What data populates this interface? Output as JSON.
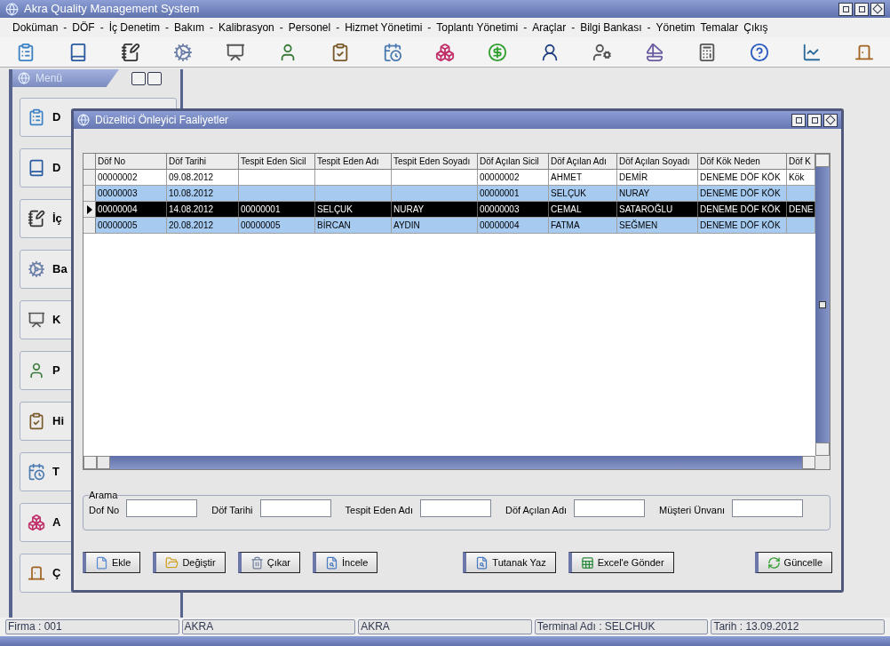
{
  "window": {
    "title": "Akra Quality Management System"
  },
  "menu_bar": [
    {
      "label": "Doküman",
      "separator": "-"
    },
    {
      "label": "DÖF",
      "separator": "-"
    },
    {
      "label": "İç Denetim",
      "separator": "-"
    },
    {
      "label": "Bakım",
      "separator": "-"
    },
    {
      "label": "Kalibrasyon",
      "separator": "-"
    },
    {
      "label": "Personel",
      "separator": "-"
    },
    {
      "label": "Hizmet Yönetimi",
      "separator": "-"
    },
    {
      "label": "Toplantı Yönetimi",
      "separator": "-"
    },
    {
      "label": "Araçlar",
      "separator": "-"
    },
    {
      "label": "Bilgi Bankası",
      "separator": "-"
    },
    {
      "label": "Yönetim"
    },
    {
      "label": "Temalar"
    },
    {
      "label": "Çıkış"
    }
  ],
  "menu_panel": {
    "title": "Menü",
    "items": [
      "D",
      "D",
      "İç",
      "Ba",
      "K",
      "P",
      "Hi",
      "T",
      "A",
      "Ç"
    ]
  },
  "dialog": {
    "title": "Düzeltici Önleyici Faaliyetler",
    "table": {
      "columns": [
        "Döf No",
        "Döf Tarihi",
        "Tespit Eden Sicil",
        "Tespit Eden Adı",
        "Tespit Eden Soyadı",
        "Döf Açılan Sicil",
        "Döf Açılan Adı",
        "Döf Açılan Soyadı",
        "Döf Kök Neden",
        "Döf K"
      ],
      "rows": [
        {
          "selected": false,
          "cells": [
            "00000002",
            "09.08.2012",
            "",
            "",
            "",
            "00000002",
            "AHMET",
            "DEMİR",
            "DENEME DÖF KÖK",
            "Kök"
          ]
        },
        {
          "selected": false,
          "cells": [
            "00000003",
            "10.08.2012",
            "",
            "",
            "",
            "00000001",
            "SELÇUK",
            "NURAY",
            "DENEME DÖF KÖK",
            ""
          ]
        },
        {
          "selected": true,
          "cells": [
            "00000004",
            "14.08.2012",
            "00000001",
            "SELÇUK",
            "NURAY",
            "00000003",
            "CEMAL",
            "SATAROĞLU",
            "DENEME DÖF KÖK",
            "DENE"
          ]
        },
        {
          "selected": false,
          "cells": [
            "00000005",
            "20.08.2012",
            "00000005",
            "BİRCAN",
            "AYDIN",
            "00000004",
            "FATMA",
            "SEĞMEN",
            "DENEME DÖF KÖK",
            ""
          ]
        }
      ]
    },
    "search": {
      "title": "Arama",
      "fields": [
        "Dof No",
        "Döf Tarihi",
        "Tespit Eden Adı",
        "Döf Açılan Adı",
        "Müşteri Ünvanı"
      ]
    },
    "buttons": [
      "Ekle",
      "Değiştir",
      "Çıkar",
      "İncele",
      "Tutanak Yaz",
      "Excel'e Gönder",
      "Güncelle"
    ]
  },
  "status_bar": [
    "Firma : 001",
    "AKRA",
    "AKRA",
    "Terminal Adı : SELCHUK",
    "Tarih : 13.09.2012"
  ]
}
